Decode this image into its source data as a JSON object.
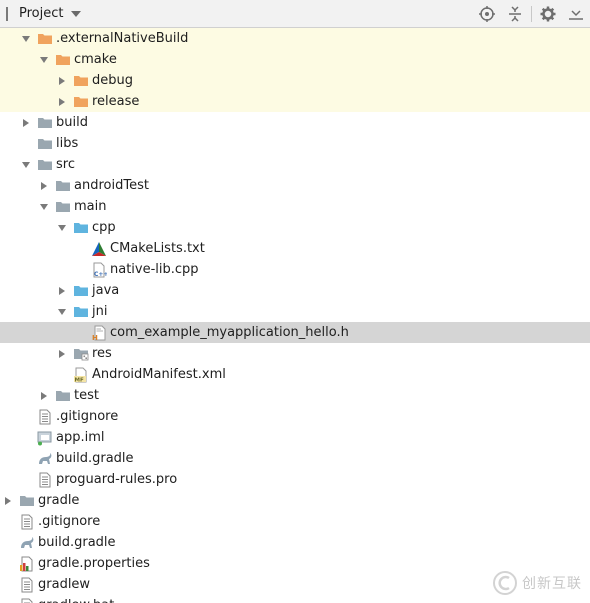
{
  "header": {
    "title": "Project",
    "tools": [
      "locate-icon",
      "collapse-icon",
      "gear-icon",
      "hide-icon"
    ]
  },
  "tree": [
    {
      "label": ".externalNativeBuild",
      "depth": 1,
      "arrow": "down",
      "icon": "folder-orange",
      "bg": "yellow"
    },
    {
      "label": "cmake",
      "depth": 2,
      "arrow": "down",
      "icon": "folder-orange",
      "bg": "yellow"
    },
    {
      "label": "debug",
      "depth": 3,
      "arrow": "right",
      "icon": "folder-orange",
      "bg": "yellow"
    },
    {
      "label": "release",
      "depth": 3,
      "arrow": "right",
      "icon": "folder-orange",
      "bg": "yellow"
    },
    {
      "label": "build",
      "depth": 1,
      "arrow": "right",
      "icon": "folder-gray",
      "bg": ""
    },
    {
      "label": "libs",
      "depth": 1,
      "arrow": "none",
      "icon": "folder-gray",
      "bg": ""
    },
    {
      "label": "src",
      "depth": 1,
      "arrow": "down",
      "icon": "folder-gray",
      "bg": ""
    },
    {
      "label": "androidTest",
      "depth": 2,
      "arrow": "right",
      "icon": "folder-gray",
      "bg": ""
    },
    {
      "label": "main",
      "depth": 2,
      "arrow": "down",
      "icon": "folder-gray",
      "bg": ""
    },
    {
      "label": "cpp",
      "depth": 3,
      "arrow": "down",
      "icon": "folder-blue",
      "bg": ""
    },
    {
      "label": "CMakeLists.txt",
      "depth": 4,
      "arrow": "none",
      "icon": "cmake-file",
      "bg": ""
    },
    {
      "label": "native-lib.cpp",
      "depth": 4,
      "arrow": "none",
      "icon": "cpp-file",
      "bg": ""
    },
    {
      "label": "java",
      "depth": 3,
      "arrow": "right",
      "icon": "folder-blue",
      "bg": ""
    },
    {
      "label": "jni",
      "depth": 3,
      "arrow": "down",
      "icon": "folder-blue",
      "bg": ""
    },
    {
      "label": "com_example_myapplication_hello.h",
      "depth": 4,
      "arrow": "none",
      "icon": "h-file",
      "bg": "selected"
    },
    {
      "label": "res",
      "depth": 3,
      "arrow": "right",
      "icon": "folder-res",
      "bg": ""
    },
    {
      "label": "AndroidManifest.xml",
      "depth": 3,
      "arrow": "none",
      "icon": "manifest-file",
      "bg": ""
    },
    {
      "label": "test",
      "depth": 2,
      "arrow": "right",
      "icon": "folder-gray",
      "bg": ""
    },
    {
      "label": ".gitignore",
      "depth": 1,
      "arrow": "none",
      "icon": "text-file",
      "bg": ""
    },
    {
      "label": "app.iml",
      "depth": 1,
      "arrow": "none",
      "icon": "iml-file",
      "bg": ""
    },
    {
      "label": "build.gradle",
      "depth": 1,
      "arrow": "none",
      "icon": "gradle-file",
      "bg": ""
    },
    {
      "label": "proguard-rules.pro",
      "depth": 1,
      "arrow": "none",
      "icon": "text-file",
      "bg": ""
    },
    {
      "label": "gradle",
      "depth": 0,
      "arrow": "right",
      "icon": "folder-gray",
      "bg": ""
    },
    {
      "label": ".gitignore",
      "depth": 0,
      "arrow": "none",
      "icon": "text-file",
      "bg": ""
    },
    {
      "label": "build.gradle",
      "depth": 0,
      "arrow": "none",
      "icon": "gradle-file",
      "bg": ""
    },
    {
      "label": "gradle.properties",
      "depth": 0,
      "arrow": "none",
      "icon": "properties-file",
      "bg": ""
    },
    {
      "label": "gradlew",
      "depth": 0,
      "arrow": "none",
      "icon": "text-file",
      "bg": ""
    },
    {
      "label": "gradlew.bat",
      "depth": 0,
      "arrow": "none",
      "icon": "text-file",
      "bg": ""
    }
  ],
  "watermark": {
    "text": "创新互联"
  },
  "colors": {
    "folder_orange": "#f0a35e",
    "folder_gray": "#9aa7b0",
    "folder_blue": "#5fb4df",
    "yellow_bg": "#fdfbe3",
    "selected_bg": "#d5d5d5"
  }
}
